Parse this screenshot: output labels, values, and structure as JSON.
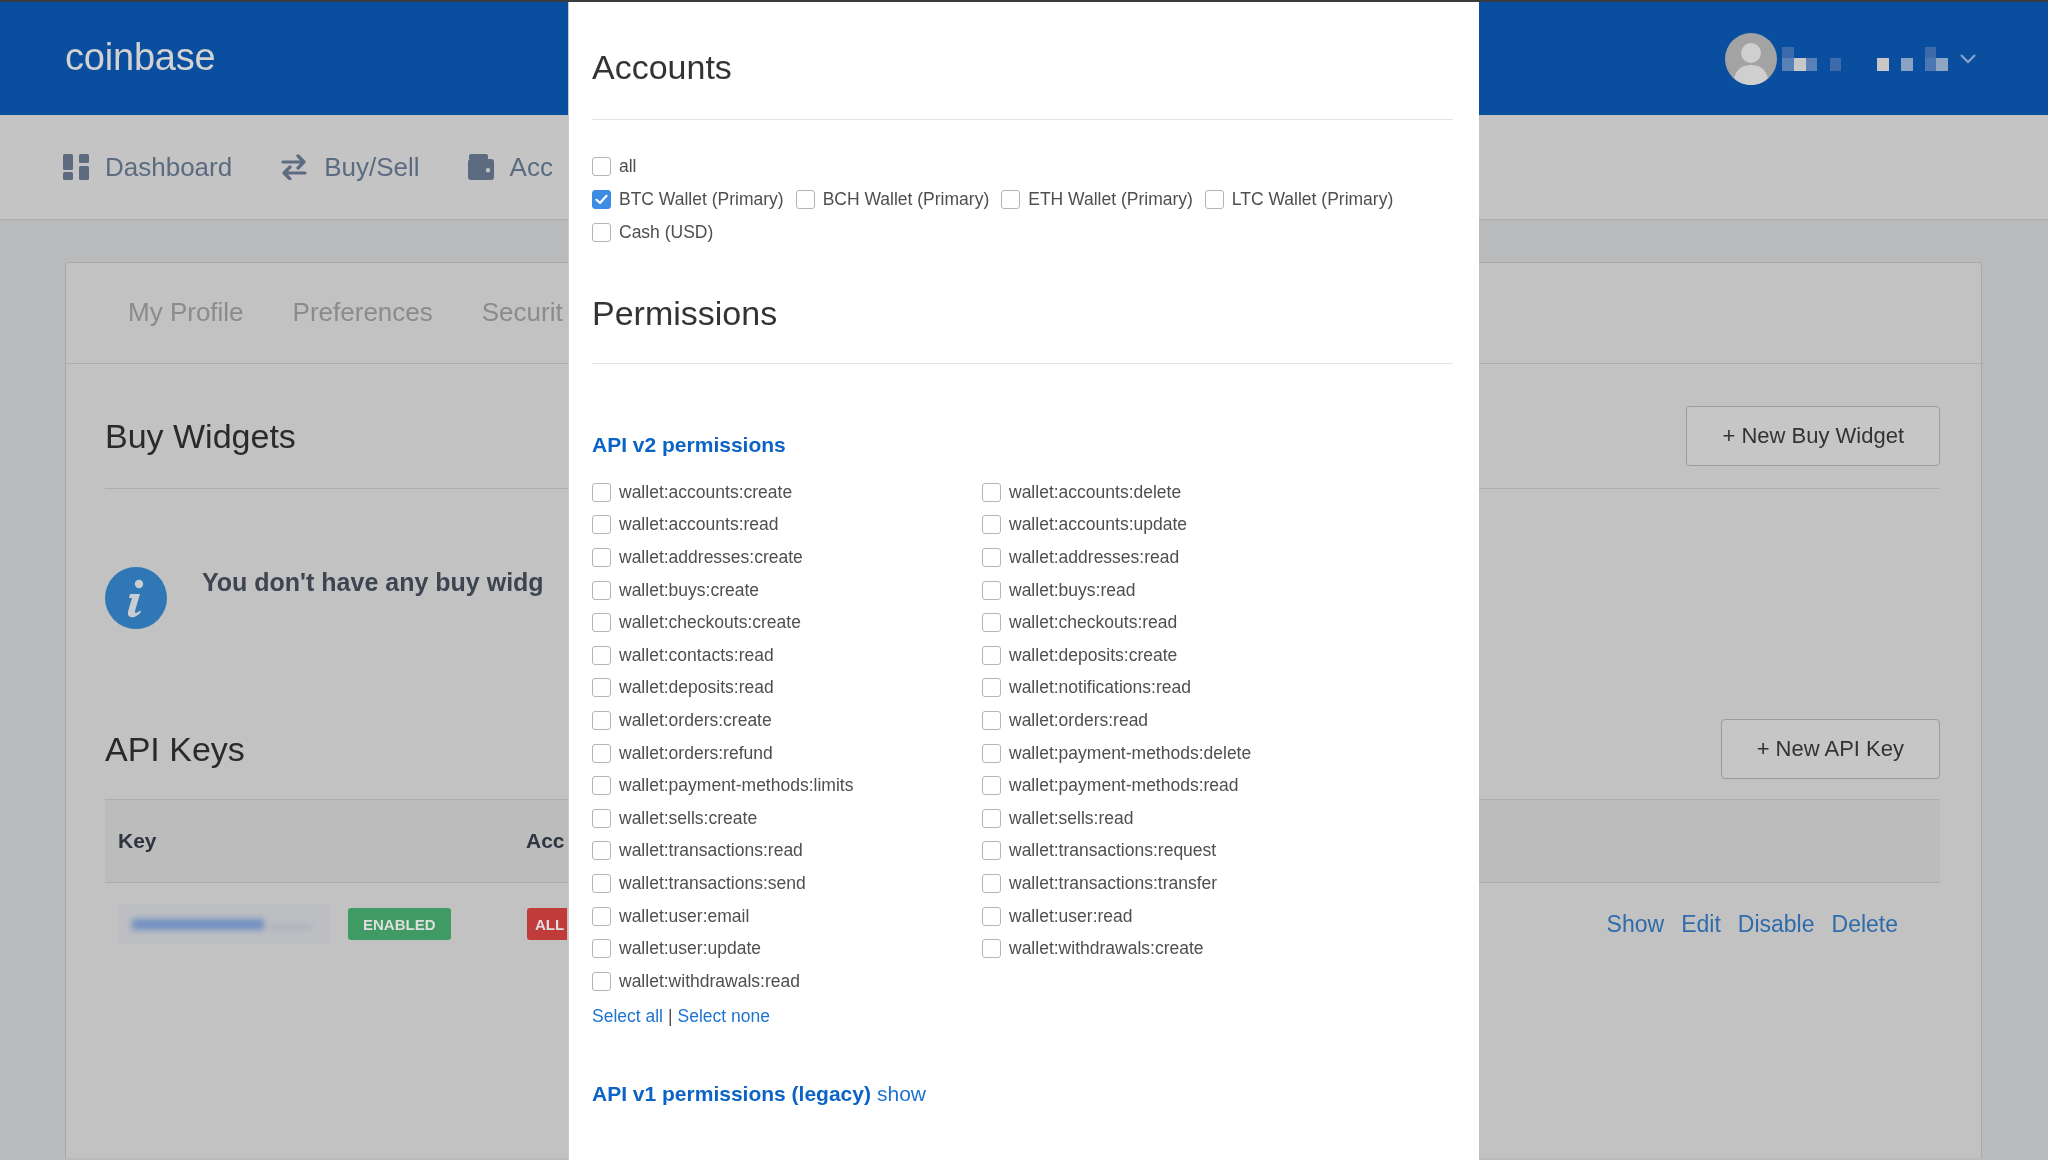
{
  "header": {
    "logo": "coinbase"
  },
  "nav": [
    {
      "label": "Dashboard",
      "selected": false
    },
    {
      "label": "Buy/Sell",
      "selected": false
    },
    {
      "label": "Acc",
      "selected": false
    }
  ],
  "settings": {
    "tabs": [
      {
        "label": "My Profile",
        "selected": false
      },
      {
        "label": "Preferences",
        "selected": false
      },
      {
        "label": "Securit",
        "selected": false
      }
    ],
    "buy_widgets": {
      "title": "Buy Widgets",
      "button": "+ New Buy Widget",
      "message": "You don't have any buy widg"
    },
    "api_keys": {
      "title": "API Keys",
      "button": "+ New API Key",
      "columns": [
        "Key",
        "Acc"
      ],
      "rows": [
        {
          "status": "ENABLED",
          "accounts": "ALL",
          "actions": [
            "Show",
            "Edit",
            "Disable",
            "Delete"
          ]
        }
      ]
    }
  },
  "modal": {
    "accounts": {
      "title": "Accounts",
      "all": {
        "label": "all",
        "checked": false
      },
      "items": [
        {
          "label": "BTC Wallet (Primary)",
          "checked": true
        },
        {
          "label": "BCH Wallet (Primary)",
          "checked": false
        },
        {
          "label": "ETH Wallet (Primary)",
          "checked": false
        },
        {
          "label": "LTC Wallet (Primary)",
          "checked": false
        },
        {
          "label": "Cash (USD)",
          "checked": false
        }
      ]
    },
    "permissions": {
      "title": "Permissions",
      "v2": {
        "title": "API v2 permissions",
        "columns": [
          {
            "items": [
              {
                "label": "wallet:accounts:create",
                "checked": false
              },
              {
                "label": "wallet:accounts:read",
                "checked": false
              },
              {
                "label": "wallet:addresses:create",
                "checked": false
              },
              {
                "label": "wallet:buys:create",
                "checked": false
              },
              {
                "label": "wallet:checkouts:create",
                "checked": false
              },
              {
                "label": "wallet:contacts:read",
                "checked": false
              },
              {
                "label": "wallet:deposits:read",
                "checked": false
              },
              {
                "label": "wallet:orders:create",
                "checked": false
              },
              {
                "label": "wallet:orders:refund",
                "checked": false
              },
              {
                "label": "wallet:payment-methods:limits",
                "checked": false
              },
              {
                "label": "wallet:sells:create",
                "checked": false
              },
              {
                "label": "wallet:transactions:read",
                "checked": false
              },
              {
                "label": "wallet:transactions:send",
                "checked": false
              },
              {
                "label": "wallet:user:email",
                "checked": false
              },
              {
                "label": "wallet:user:update",
                "checked": false
              },
              {
                "label": "wallet:withdrawals:read",
                "checked": false
              }
            ]
          },
          {
            "items": [
              {
                "label": "wallet:accounts:delete",
                "checked": false
              },
              {
                "label": "wallet:accounts:update",
                "checked": false
              },
              {
                "label": "wallet:addresses:read",
                "checked": false
              },
              {
                "label": "wallet:buys:read",
                "checked": false
              },
              {
                "label": "wallet:checkouts:read",
                "checked": false
              },
              {
                "label": "wallet:deposits:create",
                "checked": false
              },
              {
                "label": "wallet:notifications:read",
                "checked": false
              },
              {
                "label": "wallet:orders:read",
                "checked": false
              },
              {
                "label": "wallet:payment-methods:delete",
                "checked": false
              },
              {
                "label": "wallet:payment-methods:read",
                "checked": false
              },
              {
                "label": "wallet:sells:read",
                "checked": false
              },
              {
                "label": "wallet:transactions:request",
                "checked": false
              },
              {
                "label": "wallet:transactions:transfer",
                "checked": false
              },
              {
                "label": "wallet:user:read",
                "checked": false
              },
              {
                "label": "wallet:withdrawals:create",
                "checked": false
              }
            ]
          }
        ],
        "select_all": "Select all",
        "separator": "|",
        "select_none": "Select none"
      },
      "v1": {
        "title": "API v1 permissions (legacy)",
        "toggle": "show"
      }
    }
  }
}
